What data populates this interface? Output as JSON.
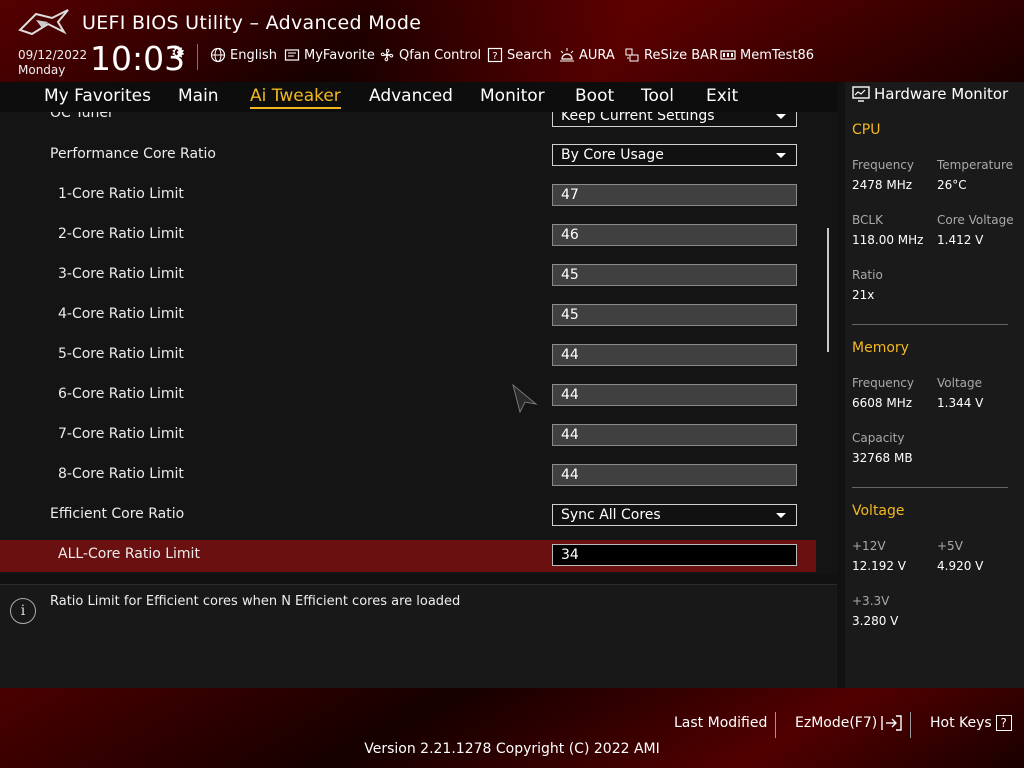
{
  "header": {
    "title": "UEFI BIOS Utility – Advanced Mode",
    "date": "09/12/2022",
    "day": "Monday",
    "time": "10:03",
    "tools": [
      {
        "label": "English",
        "icon": "globe-icon"
      },
      {
        "label": "MyFavorite",
        "icon": "favorite-icon"
      },
      {
        "label": "Qfan Control",
        "icon": "fan-icon"
      },
      {
        "label": "Search",
        "icon": "search-icon"
      },
      {
        "label": "AURA",
        "icon": "aura-icon"
      },
      {
        "label": "ReSize BAR",
        "icon": "resize-bar-icon"
      },
      {
        "label": "MemTest86",
        "icon": "memtest-icon"
      }
    ]
  },
  "menu": {
    "items": [
      "My Favorites",
      "Main",
      "Ai Tweaker",
      "Advanced",
      "Monitor",
      "Boot",
      "Tool",
      "Exit"
    ],
    "active": "Ai Tweaker"
  },
  "settings": {
    "oc_tuner": {
      "label": "OC Tuner",
      "value": "Keep Current Settings"
    },
    "performance_core_ratio": {
      "label": "Performance Core Ratio",
      "value": "By Core Usage"
    },
    "core_limits": [
      {
        "label": "1-Core Ratio Limit",
        "value": "47"
      },
      {
        "label": "2-Core Ratio Limit",
        "value": "46"
      },
      {
        "label": "3-Core Ratio Limit",
        "value": "45"
      },
      {
        "label": "4-Core Ratio Limit",
        "value": "45"
      },
      {
        "label": "5-Core Ratio Limit",
        "value": "44"
      },
      {
        "label": "6-Core Ratio Limit",
        "value": "44"
      },
      {
        "label": "7-Core Ratio Limit",
        "value": "44"
      },
      {
        "label": "8-Core Ratio Limit",
        "value": "44"
      }
    ],
    "efficient_core_ratio": {
      "label": "Efficient Core Ratio",
      "value": "Sync All Cores"
    },
    "all_core_limit": {
      "label": "ALL-Core Ratio Limit",
      "value": "34"
    }
  },
  "help": {
    "text": "Ratio Limit for Efficient cores when N Efficient cores are loaded"
  },
  "hw_monitor": {
    "title": "Hardware Monitor",
    "cpu": {
      "heading": "CPU",
      "frequency_label": "Frequency",
      "frequency": "2478 MHz",
      "temperature_label": "Temperature",
      "temperature": "26°C",
      "bclk_label": "BCLK",
      "bclk": "118.00 MHz",
      "core_voltage_label": "Core Voltage",
      "core_voltage": "1.412 V",
      "ratio_label": "Ratio",
      "ratio": "21x"
    },
    "memory": {
      "heading": "Memory",
      "frequency_label": "Frequency",
      "frequency": "6608 MHz",
      "voltage_label": "Voltage",
      "voltage": "1.344 V",
      "capacity_label": "Capacity",
      "capacity": "32768 MB"
    },
    "voltage": {
      "heading": "Voltage",
      "v12_label": "+12V",
      "v12": "12.192 V",
      "v5_label": "+5V",
      "v5": "4.920 V",
      "v33_label": "+3.3V",
      "v33": "3.280 V"
    }
  },
  "footer": {
    "last_modified": "Last Modified",
    "ezmode": "EzMode(F7)",
    "hot_keys": "Hot Keys",
    "hot_keys_key": "?",
    "version": "Version 2.21.1278 Copyright (C) 2022 AMI"
  }
}
